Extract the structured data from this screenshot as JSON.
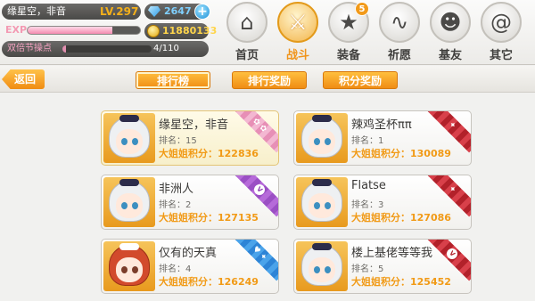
{
  "player": {
    "name": "缘星空，非音",
    "level": "LV.297",
    "gems": "2647",
    "exp_label": "EXP",
    "exp_progress": 0.75,
    "gold": "11880133",
    "bonus_label": "双倍节操点",
    "bonus_progress": 0.04,
    "bonus_count": "4/110"
  },
  "nav": [
    {
      "label": "首页",
      "icon": "home-icon",
      "glyph": "⌂",
      "active": false
    },
    {
      "label": "战斗",
      "icon": "crossed-swords-icon",
      "glyph": "⚔",
      "active": true
    },
    {
      "label": "装备",
      "icon": "gun-star-icon",
      "glyph": "★",
      "active": false,
      "badge": "5"
    },
    {
      "label": "祈愿",
      "icon": "wish-icon",
      "glyph": "∿",
      "active": false
    },
    {
      "label": "基友",
      "icon": "friend-icon",
      "glyph": "☻",
      "active": false
    },
    {
      "label": "其它",
      "icon": "snail-icon",
      "glyph": "@",
      "active": false
    }
  ],
  "subbar": {
    "back": "返回",
    "tabs": [
      "排行榜",
      "排行奖励",
      "积分奖励"
    ]
  },
  "ranking": [
    {
      "name": "缘星空，非音",
      "rank": "排名：15",
      "score": "大姐姐积分：122836",
      "ribbon": "pink"
    },
    {
      "name": "辣鸡圣杯ππ",
      "rank": "排名：1",
      "score": "大姐姐积分：130089",
      "ribbon": "red"
    },
    {
      "name": "非洲人",
      "rank": "排名：2",
      "score": "大姐姐积分：127135",
      "ribbon": "purple"
    },
    {
      "name": "Flatse",
      "rank": "排名：3",
      "score": "大姐姐积分：127086",
      "ribbon": "red"
    },
    {
      "name": "仅有的天真",
      "rank": "排名：4",
      "score": "大姐姐积分：126249",
      "ribbon": "blue"
    },
    {
      "name": "楼上基佬等等我",
      "rank": "排名：5",
      "score": "大姐姐积分：125452",
      "ribbon": "red"
    }
  ]
}
